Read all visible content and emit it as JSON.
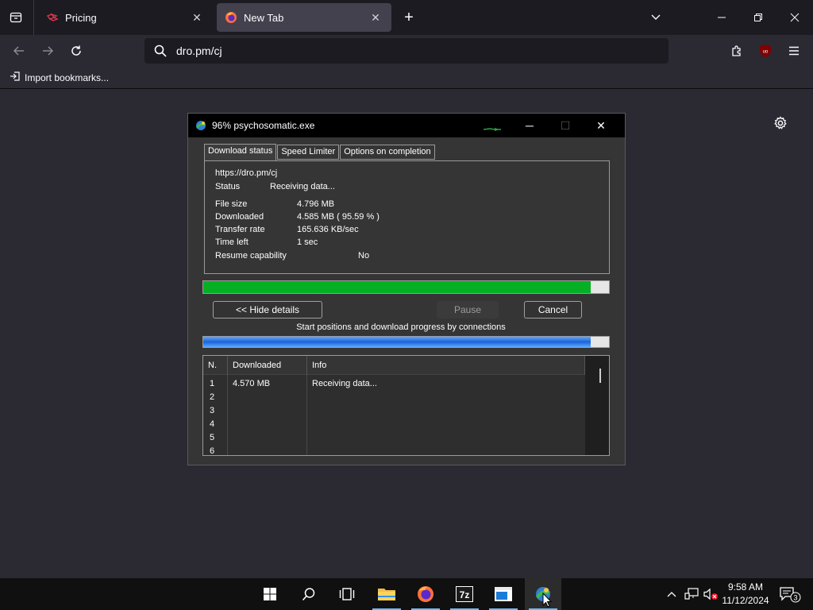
{
  "browser": {
    "tabs": [
      {
        "label": "Pricing",
        "icon": "dropbox-icon"
      },
      {
        "label": "New Tab",
        "icon": "firefox-icon",
        "active": true
      }
    ],
    "url": "dro.pm/cj",
    "bookmarks": [
      {
        "label": "Import bookmarks..."
      }
    ],
    "extension_badge": "uo"
  },
  "dialog": {
    "title": "96% psychosomatic.exe",
    "tabs": [
      "Download status",
      "Speed Limiter",
      "Options on completion"
    ],
    "url": "https://dro.pm/cj",
    "status_label": "Status",
    "status_value": "Receiving data...",
    "fields": [
      {
        "label": "File size",
        "value": "4.796  MB"
      },
      {
        "label": "Downloaded",
        "value": "4.585  MB  ( 95.59 % )"
      },
      {
        "label": "Transfer rate",
        "value": "165.636  KB/sec"
      },
      {
        "label": "Time left",
        "value": "1 sec"
      }
    ],
    "resume_label": "Resume capability",
    "resume_value": "No",
    "progress_fraction": 0.9559,
    "buttons": {
      "hide_details": "<< Hide details",
      "pause": "Pause",
      "cancel": "Cancel"
    },
    "connections_caption": "Start positions and download progress by connections",
    "connections_progress_fraction": 0.9559,
    "table": {
      "columns": [
        "N.",
        "Downloaded",
        "Info"
      ],
      "rows": [
        {
          "n": "1",
          "downloaded": "4.570  MB",
          "info": "Receiving data..."
        },
        {
          "n": "2",
          "downloaded": "",
          "info": ""
        },
        {
          "n": "3",
          "downloaded": "",
          "info": ""
        },
        {
          "n": "4",
          "downloaded": "",
          "info": ""
        },
        {
          "n": "5",
          "downloaded": "",
          "info": ""
        },
        {
          "n": "6",
          "downloaded": "",
          "info": ""
        }
      ]
    }
  },
  "taskbar": {
    "time": "9:58 AM",
    "date": "11/12/2024",
    "notification_count": "3"
  },
  "colors": {
    "progress_green": "#06b025",
    "progress_blue": "#1c64d8",
    "tab_active_bg": "#42414d",
    "page_bg": "#2b2a33"
  }
}
